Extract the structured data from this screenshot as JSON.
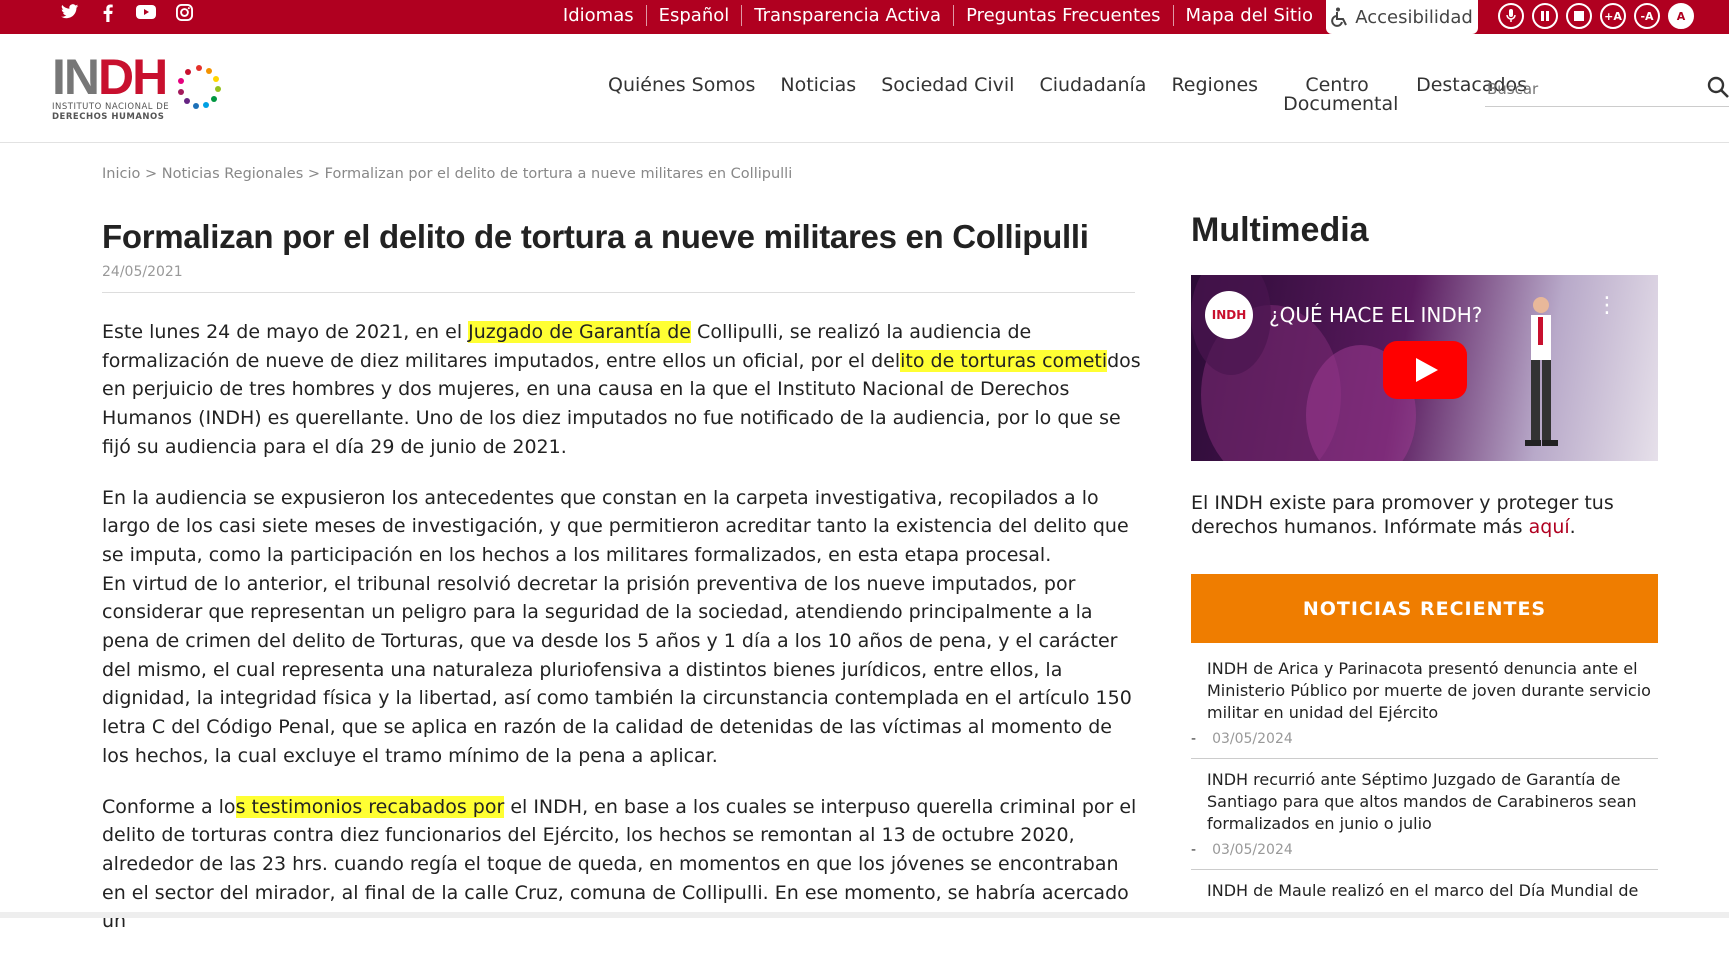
{
  "topbar": {
    "social": [
      "twitter-icon",
      "facebook-icon",
      "youtube-icon",
      "instagram-icon"
    ],
    "links": [
      "Idiomas",
      "Español",
      "Transparencia Activa",
      "Preguntas Frecuentes",
      "Mapa del Sitio"
    ],
    "accessibility_label": "Accesibilidad",
    "tools": [
      "microphone-icon",
      "pause-icon",
      "stop-icon",
      "+A",
      "-A",
      "A"
    ]
  },
  "logo": {
    "mark_in": "IN",
    "mark_dh": "DH",
    "line1": "INSTITUTO NACIONAL DE",
    "line2": "DERECHOS HUMANOS"
  },
  "nav": [
    "Quiénes Somos",
    "Noticias",
    "Sociedad Civil",
    "Ciudadanía",
    "Regiones",
    "Centro Documental",
    "Destacados"
  ],
  "search": {
    "placeholder": "Buscar"
  },
  "breadcrumb": {
    "home": "Inicio",
    "section": "Noticias Regionales",
    "current": "Formalizan por el delito de tortura a nueve militares en Collipulli"
  },
  "article": {
    "title": "Formalizan por el delito de tortura a nueve militares en Collipulli",
    "date": "24/05/2021",
    "p1a": "Este lunes 24 de mayo de 2021, en el ",
    "p1b": "Juzgado de Garantía de",
    "p1c": " Collipulli, se realizó la audiencia de formalización de nueve de diez militares imputados, entre ellos un oficial, por el del",
    "p1d": "ito de torturas cometi",
    "p1e": "dos en perjuicio de tres hombres y dos mujeres, en una causa en la que el Instituto Nacional de Derechos Humanos (INDH) es querellante. Uno de los diez imputados no fue notificado de la audiencia, por lo que se fijó su audiencia para el día 29 de junio de 2021.",
    "p2": "En la audiencia se expusieron los antecedentes que constan en la carpeta investigativa, recopilados a lo largo de los casi siete meses de investigación, y que permitieron acreditar tanto la existencia del delito que se imputa, como la participación en los hechos a los militares formalizados, en esta etapa procesal.",
    "p3": "En virtud de lo anterior, el tribunal resolvió decretar la prisión preventiva de los nueve imputados, por considerar que representan un peligro para la seguridad de la sociedad, atendiendo principalmente a la pena de crimen del delito de Torturas, que va desde los 5 años y 1 día a los 10 años de pena, y el carácter del mismo, el cual representa una naturaleza pluriofensiva a distintos bienes jurídicos, entre ellos, la dignidad, la integridad física y la libertad, así como también la circunstancia contemplada en el artículo 150 letra C del Código Penal, que se aplica en razón de la calidad de detenidas de las víctimas al momento de los hechos, la cual excluye el tramo mínimo de la pena a aplicar.",
    "p4a": "Conforme a lo",
    "p4b": "s testimonios recabados por",
    "p4c": " el INDH, en base a los cuales se interpuso querella criminal por el delito de torturas contra diez funcionarios del Ejército, los hechos se remontan al 13 de octubre 2020, alrededor de las 23 hrs. cuando regía el toque de queda, en momentos en que los jóvenes se encontraban en el sector del mirador, al final de la calle Cruz, comuna de Collipulli. En ese momento, se habría acercado un"
  },
  "sidebar": {
    "title": "Multimedia",
    "video_logo": "INDH",
    "video_title": "¿QUÉ HACE EL INDH?",
    "text": "El INDH existe para promover y proteger tus derechos humanos. Infórmate más ",
    "link": "aquí",
    "link_end": ".",
    "news_heading": "NOTICIAS RECIENTES",
    "news": [
      {
        "title": "INDH de Arica y Parinacota presentó denuncia ante el Ministerio Público por muerte de joven durante servicio militar en unidad del Ejército",
        "date": "03/05/2024"
      },
      {
        "title": "INDH recurrió ante Séptimo Juzgado de Garantía de Santiago para que altos mandos de Carabineros sean formalizados en junio o julio",
        "date": "03/05/2024"
      },
      {
        "title": "INDH de Maule realizó en el marco del Día Mundial de",
        "date": ""
      }
    ]
  }
}
